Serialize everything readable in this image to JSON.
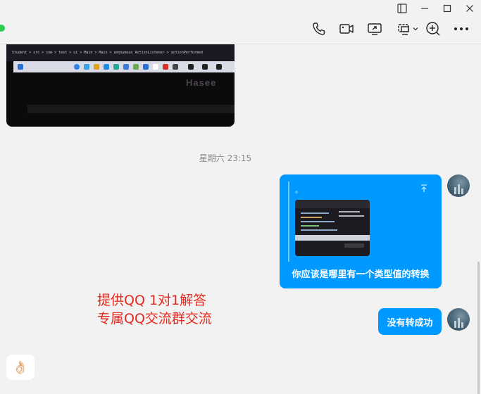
{
  "window": {
    "controls": {
      "sidebar_icon": "sidebar-toggle-icon",
      "minimize_icon": "minimize-icon",
      "maximize_icon": "maximize-icon",
      "close_icon": "close-icon"
    }
  },
  "header": {
    "status": "online",
    "tools": [
      "phone-icon",
      "video-call-icon",
      "screen-share-icon",
      "remote-assist-icon",
      "add-member-icon",
      "more-icon"
    ]
  },
  "chat": {
    "received_image": {
      "path_text": "Student > src > com > test > ui > Main > Main > anonymous ActionListener > actionPerformed",
      "brand": "Hasee"
    },
    "timestamp": "星期六 23:15",
    "outgoing": [
      {
        "type": "quote_image",
        "quote_marker": "。",
        "text": "你应该是哪里有一个类型值的转换"
      },
      {
        "type": "text",
        "text": "没有转成功"
      }
    ]
  },
  "overlay_ad": {
    "line1": "提供QQ 1对1解答",
    "line2": "专属QQ交流群交流"
  },
  "emoji_button": "👌🏻",
  "colors": {
    "bubble": "#0099ff",
    "background": "#f2f2f2",
    "ad_text": "#e52a1f",
    "online": "#2fcc4f"
  }
}
